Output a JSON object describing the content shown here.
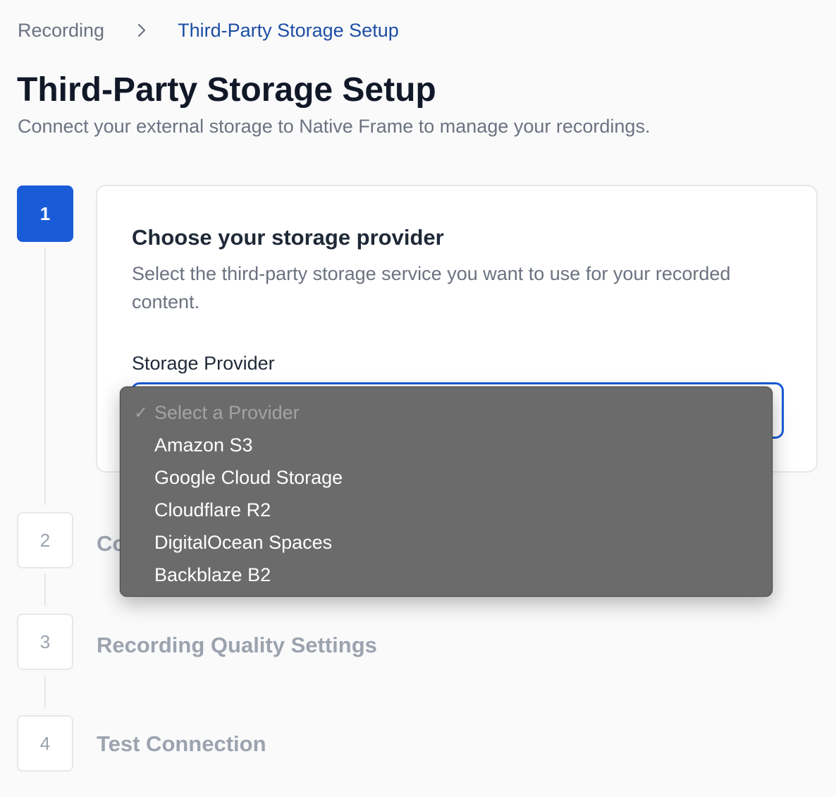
{
  "breadcrumb": {
    "parent": "Recording",
    "separator_icon": "chevron-right-icon",
    "current": "Third-Party Storage Setup"
  },
  "page": {
    "title": "Third-Party Storage Setup",
    "subtitle": "Connect your external storage to Native Frame to manage your recordings."
  },
  "steps": [
    {
      "number": "1",
      "title": "Choose your storage provider",
      "active": true
    },
    {
      "number": "2",
      "title": "Co",
      "active": false
    },
    {
      "number": "3",
      "title": "Recording Quality Settings",
      "active": false
    },
    {
      "number": "4",
      "title": "Test Connection",
      "active": false
    }
  ],
  "card": {
    "title": "Choose your storage provider",
    "description": "Select the third-party storage service you want to use for your recorded content.",
    "field_label": "Storage Provider"
  },
  "dropdown": {
    "check_mark": "✓",
    "placeholder": "Select a Provider",
    "options": [
      "Amazon S3",
      "Google Cloud Storage",
      "Cloudflare R2",
      "DigitalOcean Spaces",
      "Backblaze B2"
    ]
  },
  "colors": {
    "accent": "#1a5bd8",
    "breadcrumb_current": "#1d4ea3",
    "dropdown_bg": "#6b6b6b",
    "muted_text": "#9ca3af"
  }
}
